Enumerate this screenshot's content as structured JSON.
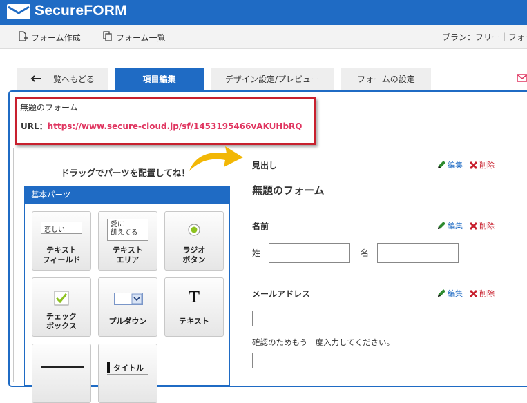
{
  "app": {
    "logo_text": "SecureFORM"
  },
  "subnav": {
    "create": "フォーム作成",
    "list": "フォーム一覧",
    "plan": "プラン：フリー｜フォー"
  },
  "tabs": [
    {
      "label": "一覧へもどる"
    },
    {
      "label": "項目編集"
    },
    {
      "label": "デザイン設定/プレビュー"
    },
    {
      "label": "フォームの設定"
    }
  ],
  "form_info": {
    "name": "無題のフォーム",
    "url_label": "URL：",
    "url_value": "https://www.secure-cloud.jp/sf/1453195466vAKUHbRQ"
  },
  "left": {
    "drag_hint": "ドラッグでパーツを配置してね！",
    "parts_title": "基本パーツ",
    "parts": [
      {
        "label_line1": "テキスト",
        "label_line2": "フィールド",
        "sample": "恋しい"
      },
      {
        "label_line1": "テキスト",
        "label_line2": "エリア",
        "sample_line1": "愛に",
        "sample_line2": "飢えてる"
      },
      {
        "label_line1": "ラジオ",
        "label_line2": "ボタン"
      },
      {
        "label_line1": "チェック",
        "label_line2": "ボックス"
      },
      {
        "label_line1": "プルダウン"
      },
      {
        "label_line1": "テキスト",
        "glyph": "T"
      },
      {
        "label_line1": ""
      },
      {
        "sample": "タイトル"
      }
    ]
  },
  "right": {
    "heading_section": {
      "label": "見出し",
      "value": "無題のフォーム"
    },
    "name_section": {
      "label": "名前",
      "sei": "姓",
      "mei": "名"
    },
    "email_section": {
      "label": "メールアドレス",
      "confirm": "確認のためもう一度入力してください。"
    },
    "edit": "編集",
    "delete": "削除"
  },
  "colors": {
    "brand": "#1f6bc4",
    "highlight": "#c8202e",
    "url": "#e03560",
    "arrow": "#f2b705"
  }
}
